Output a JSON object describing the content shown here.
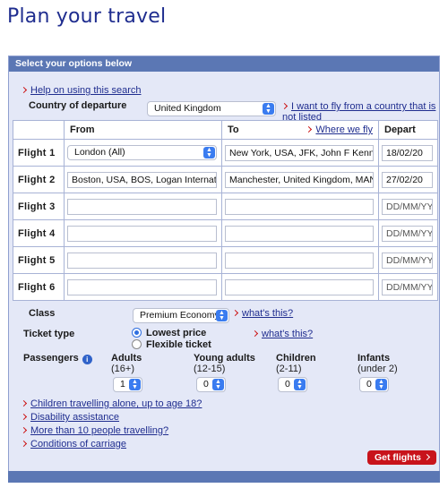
{
  "page": {
    "title": "Plan your travel"
  },
  "panel": {
    "header": "Select your options below"
  },
  "help_link": "Help on using this search",
  "country": {
    "label": "Country of departure",
    "value": "United Kingdom",
    "alt_link": "I want to fly from a country that is not listed"
  },
  "flights_table": {
    "headers": {
      "from": "From",
      "to": "To",
      "where_we_fly": "Where we fly",
      "depart": "Depart"
    },
    "rows": [
      {
        "label": "Flight  1",
        "from": "London (All)",
        "to": "New York, USA, JFK, John F Kennedy",
        "depart": "18/02/20"
      },
      {
        "label": "Flight  2",
        "from": "Boston, USA, BOS, Logan International",
        "to": "Manchester, United Kingdom, MAN, Manchester",
        "depart": "27/02/20"
      },
      {
        "label": "Flight  3",
        "from": "",
        "to": "",
        "depart": "DD/MM/YY"
      },
      {
        "label": "Flight  4",
        "from": "",
        "to": "",
        "depart": "DD/MM/YY"
      },
      {
        "label": "Flight  5",
        "from": "",
        "to": "",
        "depart": "DD/MM/YY"
      },
      {
        "label": "Flight  6",
        "from": "",
        "to": "",
        "depart": "DD/MM/YY"
      }
    ]
  },
  "class": {
    "label": "Class",
    "value": "Premium Economy",
    "whats_this": "what's this?"
  },
  "ticket_type": {
    "label": "Ticket type",
    "options": [
      {
        "label": "Lowest price",
        "selected": true
      },
      {
        "label": "Flexible ticket",
        "selected": false
      }
    ],
    "whats_this": "what's this?"
  },
  "passengers": {
    "label": "Passengers",
    "groups": [
      {
        "title": "Adults",
        "sub": "(16+)",
        "value": "1"
      },
      {
        "title": "Young adults",
        "sub": "(12-15)",
        "value": "0"
      },
      {
        "title": "Children",
        "sub": "(2-11)",
        "value": "0"
      },
      {
        "title": "Infants",
        "sub": "(under 2)",
        "value": "0"
      }
    ]
  },
  "links": [
    "Children travelling alone, up to age 18?",
    "Disability assistance",
    "More than 10 people travelling?",
    "Conditions of carriage"
  ],
  "submit_label": "Get flights",
  "colors": {
    "brand_blue": "#1f2d8f",
    "header_bar": "#5b77b4",
    "panel_bg": "#e4e8f7",
    "cta_red": "#c8131b",
    "select_blue": "#3a7cf0"
  },
  "icons": {
    "arrow": "chevron-right-icon",
    "select": "select-arrows-icon",
    "info": "info-icon"
  }
}
